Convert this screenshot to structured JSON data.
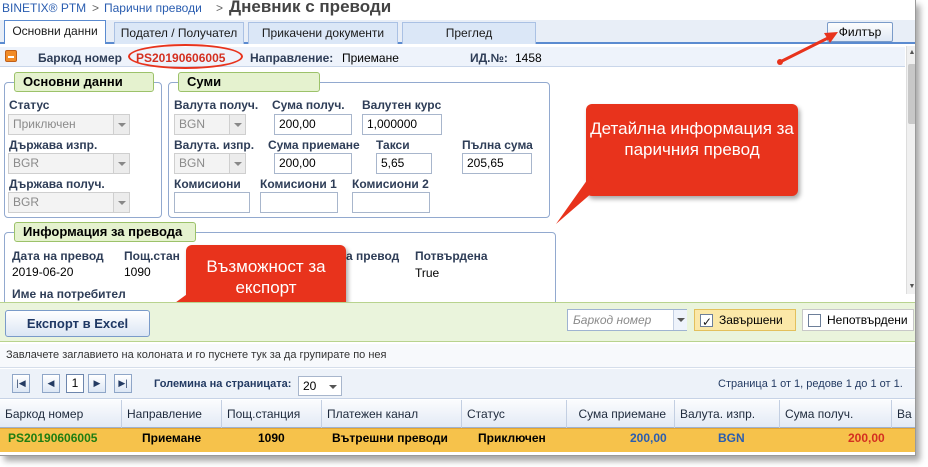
{
  "breadcrumb": {
    "app": "BINETIX® PTM",
    "sep": ">",
    "section": "Парични преводи",
    "sep2": ">",
    "title": "Дневник с преводи"
  },
  "tabs": [
    "Основни данни",
    "Подател / Получател",
    "Прикачени документи",
    "Преглед"
  ],
  "filter_button": "Филтър",
  "header": {
    "barcode_label": "Баркод номер",
    "barcode_value": "PS20190606005",
    "direction_label": "Направление:",
    "direction_value": "Приемане",
    "id_label": "ИД.№:",
    "id_value": "1458"
  },
  "basic_data": {
    "title": "Основни данни",
    "status_label": "Статус",
    "status_value": "Приключен",
    "country_sender_label": "Държава изпр.",
    "country_sender_value": "BGR",
    "country_receiver_label": "Държава получ.",
    "country_receiver_value": "BGR"
  },
  "amounts": {
    "title": "Суми",
    "currency_recv_label": "Валута получ.",
    "currency_recv_value": "BGN",
    "amount_recv_label": "Сума получ.",
    "amount_recv_value": "200,00",
    "rate_label": "Валутен курс",
    "rate_value": "1,000000",
    "currency_send_label": "Валута. изпр.",
    "currency_send_value": "BGN",
    "amount_accept_label": "Сума приемане",
    "amount_accept_value": "200,00",
    "fees_label": "Такси",
    "fees_value": "5,65",
    "total_label": "Пълна сума",
    "total_value": "205,65",
    "commissions_label": "Комисиони",
    "commissions1_label": "Комисиони 1",
    "commissions2_label": "Комисиони 2"
  },
  "transfer_info": {
    "title": "Информация за превода",
    "date_label": "Дата на превод",
    "date_value": "2019-06-20",
    "post_label": "Пощ.стан",
    "post_value": "1090",
    "transfer_label": "а превод",
    "confirmed_label": "Потвърдена",
    "confirmed_value": "True",
    "user_label": "Име на потребител"
  },
  "callouts": {
    "details": "Детайлна информация за паричния превод",
    "export": "Възможност за експорт"
  },
  "toolbar": {
    "export_label": "Експорт в Excel",
    "barcode_placeholder": "Баркод номер",
    "completed_label": "Завършени",
    "unconfirmed_label": "Непотвърдени"
  },
  "grid": {
    "group_hint": "Завлачете заглавието на колоната и го пуснете тук за да групирате по нея",
    "pager": {
      "current_page": "1",
      "page_size_label": "Големина на страницата:",
      "page_size": "20",
      "summary": "Страница 1 от 1, редове 1 до 1 от 1."
    },
    "columns": [
      "Баркод номер",
      "Направление",
      "Пощ.станция",
      "Платежен канал",
      "Статус",
      "Сума приемане",
      "Валута. изпр.",
      "Сума получ.",
      "Ва"
    ],
    "row": {
      "barcode": "PS20190606005",
      "direction": "Приемане",
      "post": "1090",
      "channel": "Вътрешни преводи",
      "status": "Приключен",
      "amount_accept": "200,00",
      "currency_send": "BGN",
      "amount_recv": "200,00"
    }
  },
  "colors": {
    "accent": "#e8331c",
    "tab_border": "#5b8bd0",
    "group_title_bg": "#e5f2cf",
    "selected_row": "#f6c24b",
    "barcode_green": "#1e7d12",
    "amount_blue": "#2a5db0",
    "amount_red": "#d42f20"
  }
}
